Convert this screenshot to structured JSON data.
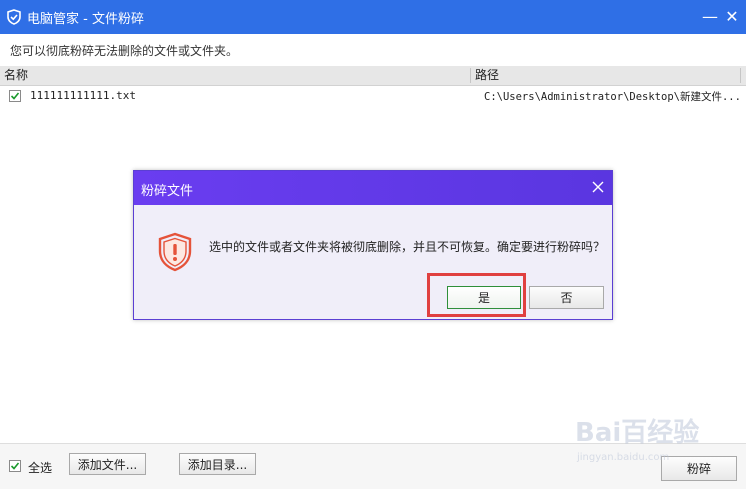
{
  "window": {
    "title": "电脑管家 - 文件粉碎",
    "minimize_glyph": "—",
    "close_glyph": "✕"
  },
  "description": "您可以彻底粉碎无法删除的文件或文件夹。",
  "table": {
    "columns": [
      "名称",
      "路径"
    ],
    "rows": [
      {
        "checked": true,
        "name": "111111111111.txt",
        "path": "C:\\Users\\Administrator\\Desktop\\新建文件..."
      }
    ]
  },
  "bottom": {
    "select_all_label": "全选",
    "select_all_checked": true,
    "add_file_label": "添加文件...",
    "add_dir_label": "添加目录...",
    "shred_label": "粉碎"
  },
  "dialog": {
    "title": "粉碎文件",
    "message": "选中的文件或者文件夹将被彻底删除，并且不可恢复。确定要进行粉碎吗？",
    "yes_label": "是",
    "no_label": "否",
    "close_icon": "close-icon",
    "warning_icon": "shield-warning-icon"
  },
  "watermark": {
    "text": "Bai百经验",
    "sub": "jingyan.baidu.com"
  },
  "colors": {
    "titlebar": "#2f6fe6",
    "dialog_titlebar": "#6a3df0",
    "warning": "#e5533a",
    "highlight": "#e04040"
  }
}
